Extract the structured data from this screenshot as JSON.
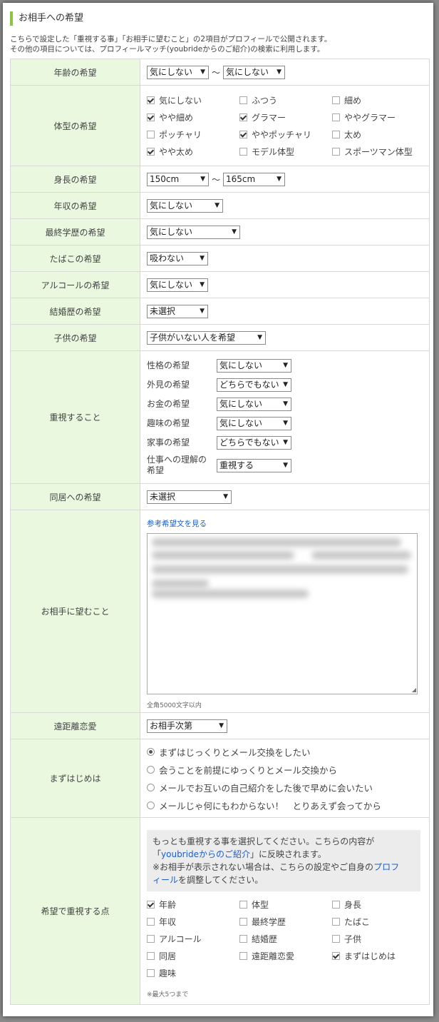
{
  "section_title": "お相手への希望",
  "description": [
    "こちらで設定した「重視する事」「お相手に望むこと」の2項目がプロフィールで公開されます。",
    "その他の項目については、プロフィールマッチ(youbrideからのご紹介)の検索に利用します。"
  ],
  "age": {
    "label": "年齢の希望",
    "from": "気にしない",
    "to": "気にしない",
    "tilde": "～"
  },
  "body_type": {
    "label": "体型の希望",
    "options": [
      {
        "text": "気にしない",
        "checked": true
      },
      {
        "text": "ふつう",
        "checked": false
      },
      {
        "text": "細め",
        "checked": false
      },
      {
        "text": "やや細め",
        "checked": true
      },
      {
        "text": "グラマー",
        "checked": true
      },
      {
        "text": "ややグラマー",
        "checked": false
      },
      {
        "text": "ポッチャリ",
        "checked": false
      },
      {
        "text": "ややポッチャリ",
        "checked": true
      },
      {
        "text": "太め",
        "checked": false
      },
      {
        "text": "やや太め",
        "checked": true
      },
      {
        "text": "モデル体型",
        "checked": false
      },
      {
        "text": "スポーツマン体型",
        "checked": false
      }
    ]
  },
  "height": {
    "label": "身長の希望",
    "from": "150cm",
    "to": "165cm",
    "tilde": "～"
  },
  "income": {
    "label": "年収の希望",
    "value": "気にしない"
  },
  "education": {
    "label": "最終学歴の希望",
    "value": "気にしない"
  },
  "tobacco": {
    "label": "たばこの希望",
    "value": "吸わない"
  },
  "alcohol": {
    "label": "アルコールの希望",
    "value": "気にしない"
  },
  "marriage": {
    "label": "結婚歴の希望",
    "value": "未選択"
  },
  "children": {
    "label": "子供の希望",
    "value": "子供がいない人を希望"
  },
  "priorities": {
    "label": "重視すること",
    "rows": [
      {
        "label": "性格の希望",
        "value": "気にしない"
      },
      {
        "label": "外見の希望",
        "value": "どちらでもない"
      },
      {
        "label": "お金の希望",
        "value": "気にしない"
      },
      {
        "label": "趣味の希望",
        "value": "気にしない"
      },
      {
        "label": "家事の希望",
        "value": "どちらでもない"
      },
      {
        "label": "仕事への理解の希望",
        "value": "重視する"
      }
    ]
  },
  "cohabit": {
    "label": "同居への希望",
    "value": "未選択"
  },
  "wish": {
    "label": "お相手に望むこと",
    "link": "参考希望文を見る",
    "note": "全角5000文字以内"
  },
  "distance": {
    "label": "遠距離恋愛",
    "value": "お相手次第"
  },
  "first_step": {
    "label": "まずはじめは",
    "options": [
      {
        "text": "まずはじっくりとメール交換をしたい",
        "checked": true
      },
      {
        "text": "会うことを前提にゆっくりとメール交換から",
        "checked": false
      },
      {
        "text": "メールでお互いの自己紹介をした後で早めに会いたい",
        "checked": false
      },
      {
        "text": "メールじゃ何にもわからない！　とりあえず会ってから",
        "checked": false
      }
    ]
  },
  "important": {
    "label": "希望で重視する点",
    "info_1": "もっとも重視する事を選択してください。こちらの内容が",
    "info_2a": "「",
    "info_2_link": "youbrideからのご紹介",
    "info_2b": "」に反映されます。",
    "info_3a": "※お相手が表示されない場合は、こちらの設定やご自身の",
    "info_3_link1": "プロフ",
    "info_3_link2": "ィール",
    "info_3b": "を調整してください。",
    "options": [
      {
        "text": "年齢",
        "checked": true
      },
      {
        "text": "体型",
        "checked": false
      },
      {
        "text": "身長",
        "checked": false
      },
      {
        "text": "年収",
        "checked": false
      },
      {
        "text": "最終学歴",
        "checked": false
      },
      {
        "text": "たばこ",
        "checked": false
      },
      {
        "text": "アルコール",
        "checked": false
      },
      {
        "text": "結婚歴",
        "checked": false
      },
      {
        "text": "子供",
        "checked": false
      },
      {
        "text": "同居",
        "checked": false
      },
      {
        "text": "遠距離恋愛",
        "checked": false
      },
      {
        "text": "まずはじめは",
        "checked": true
      },
      {
        "text": "趣味",
        "checked": false
      }
    ],
    "note": "※最大5つまで"
  },
  "colors": {
    "label_bg": "#eaf8e0",
    "accent": "#8cc63f",
    "link": "#1a5fc8"
  }
}
